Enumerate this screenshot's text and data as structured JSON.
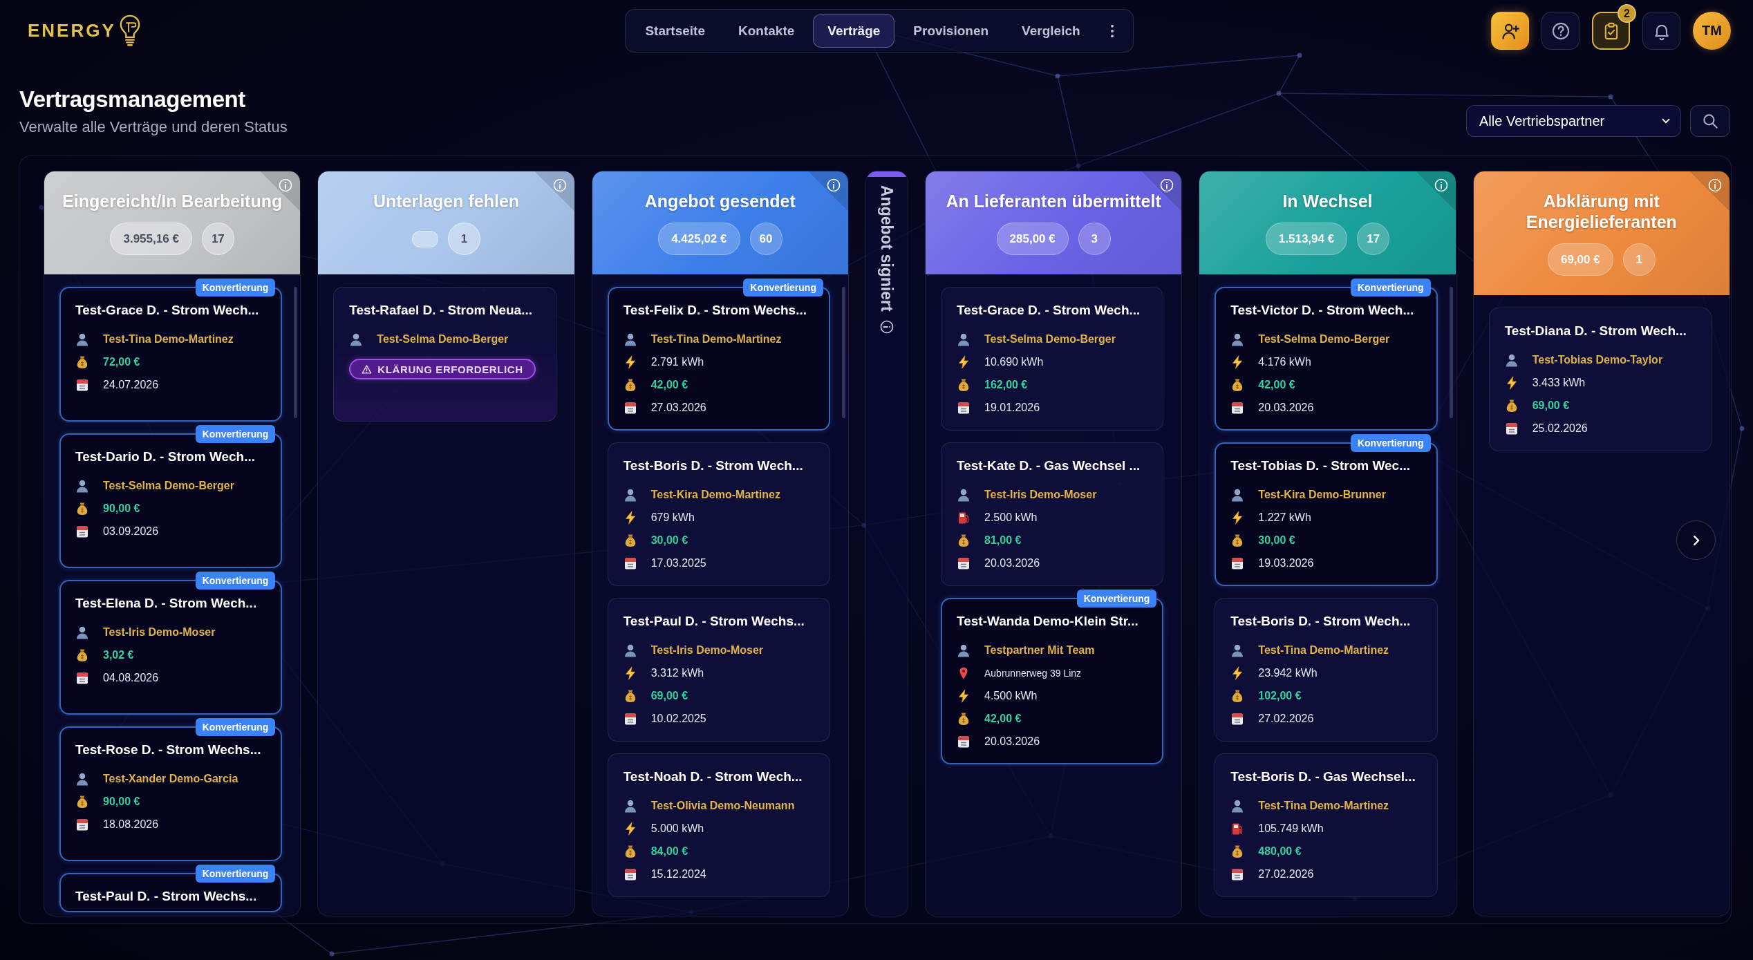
{
  "logo": {
    "text": "ENERGY"
  },
  "nav": {
    "items": [
      {
        "label": "Startseite",
        "selected": false
      },
      {
        "label": "Kontakte",
        "selected": false
      },
      {
        "label": "Verträge",
        "selected": true
      },
      {
        "label": "Provisionen",
        "selected": false
      },
      {
        "label": "Vergleich",
        "selected": false
      }
    ]
  },
  "actions": [
    {
      "kind": "add-contact"
    },
    {
      "kind": "help"
    },
    {
      "kind": "tasks",
      "badge": "2"
    },
    {
      "kind": "notifications"
    }
  ],
  "avatar": {
    "initials": "TM"
  },
  "page": {
    "title": "Vertragsmanagement",
    "subtitle": "Verwalte alle Verträge und deren Status"
  },
  "filter": {
    "value": "Alle Vertriebspartner"
  },
  "columns": [
    {
      "title": "Eingereicht/In Bearbeitung",
      "color": "#c4c5c9",
      "collapsed": false,
      "scrollable": true,
      "amount": "3.955,16 €",
      "count": "17",
      "cards": [
        {
          "title": "Test-Grace D. - Strom Wech...",
          "badge": "Konvertierung",
          "rows": [
            {
              "kind": "person",
              "text": "Test-Tina Demo-Martinez"
            },
            {
              "kind": "money",
              "text": "72,00 €"
            },
            {
              "kind": "date",
              "text": "24.07.2026"
            }
          ]
        },
        {
          "title": "Test-Dario D. - Strom Wech...",
          "badge": "Konvertierung",
          "rows": [
            {
              "kind": "person",
              "text": "Test-Selma Demo-Berger"
            },
            {
              "kind": "money",
              "text": "90,00 €"
            },
            {
              "kind": "date",
              "text": "03.09.2026"
            }
          ]
        },
        {
          "title": "Test-Elena D. - Strom Wech...",
          "badge": "Konvertierung",
          "rows": [
            {
              "kind": "person",
              "text": "Test-Iris Demo-Moser"
            },
            {
              "kind": "money",
              "text": "3,02 €"
            },
            {
              "kind": "date",
              "text": "04.08.2026"
            }
          ]
        },
        {
          "title": "Test-Rose D. - Strom Wechs...",
          "badge": "Konvertierung",
          "rows": [
            {
              "kind": "person",
              "text": "Test-Xander Demo-Garcia"
            },
            {
              "kind": "money",
              "text": "90,00 €"
            },
            {
              "kind": "date",
              "text": "18.08.2026"
            }
          ]
        },
        {
          "title": "Test-Paul D. - Strom Wechs...",
          "badge": "Konvertierung"
        }
      ]
    },
    {
      "title": "Unterlagen fehlen",
      "color": "#aac6ec",
      "collapsed": false,
      "scrollable": false,
      "count": "1",
      "cards": [
        {
          "title": "Test-Rafael D. - Strom Neua...",
          "rows": [
            {
              "kind": "person",
              "text": "Test-Selma Demo-Berger"
            }
          ],
          "alert": "KLÄRUNG ERFORDERLICH"
        }
      ]
    },
    {
      "title": "Angebot gesendet",
      "color": "#3d7fea",
      "collapsed": false,
      "scrollable": true,
      "amount": "4.425,02 €",
      "count": "60",
      "cards": [
        {
          "title": "Test-Felix D. - Strom Wechs...",
          "badge": "Konvertierung",
          "rows": [
            {
              "kind": "person",
              "text": "Test-Tina Demo-Martinez"
            },
            {
              "kind": "energy",
              "text": "2.791 kWh"
            },
            {
              "kind": "money",
              "text": "42,00 €"
            },
            {
              "kind": "date",
              "text": "27.03.2026"
            }
          ]
        },
        {
          "title": "Test-Boris D. - Strom Wech...",
          "rows": [
            {
              "kind": "person",
              "text": "Test-Kira Demo-Martinez"
            },
            {
              "kind": "energy",
              "text": "679 kWh"
            },
            {
              "kind": "money",
              "text": "30,00 €"
            },
            {
              "kind": "date",
              "text": "17.03.2025"
            }
          ]
        },
        {
          "title": "Test-Paul D. - Strom Wechs...",
          "rows": [
            {
              "kind": "person",
              "text": "Test-Iris Demo-Moser"
            },
            {
              "kind": "energy",
              "text": "3.312 kWh"
            },
            {
              "kind": "money",
              "text": "69,00 €"
            },
            {
              "kind": "date",
              "text": "10.02.2025"
            }
          ]
        },
        {
          "title": "Test-Noah D. - Strom Wech...",
          "rows": [
            {
              "kind": "person",
              "text": "Test-Olivia Demo-Neumann"
            },
            {
              "kind": "energy",
              "text": "5.000 kWh"
            },
            {
              "kind": "money",
              "text": "84,00 €"
            },
            {
              "kind": "date",
              "text": "15.12.2024"
            }
          ]
        }
      ]
    },
    {
      "title": "Angebot signiert",
      "color": "#7c5cf0",
      "collapsed": true
    },
    {
      "title": "An Lieferanten übermittelt",
      "color": "#6a63e6",
      "collapsed": false,
      "scrollable": false,
      "amount": "285,00 €",
      "count": "3",
      "cards": [
        {
          "title": "Test-Grace D. - Strom Wech...",
          "rows": [
            {
              "kind": "person",
              "text": "Test-Selma Demo-Berger"
            },
            {
              "kind": "energy",
              "text": "10.690 kWh"
            },
            {
              "kind": "money",
              "text": "162,00 €"
            },
            {
              "kind": "date",
              "text": "19.01.2026"
            }
          ]
        },
        {
          "title": "Test-Kate D. - Gas Wechsel ...",
          "rows": [
            {
              "kind": "person",
              "text": "Test-Iris Demo-Moser"
            },
            {
              "kind": "gas",
              "text": "2.500 kWh"
            },
            {
              "kind": "money",
              "text": "81,00 €"
            },
            {
              "kind": "date",
              "text": "20.03.2026"
            }
          ]
        },
        {
          "title": "Test-Wanda Demo-Klein Str...",
          "badge": "Konvertierung",
          "rows": [
            {
              "kind": "person",
              "text": "Testpartner Mit Team"
            },
            {
              "kind": "location",
              "text": "Aubrunnerweg 39 Linz"
            },
            {
              "kind": "energy",
              "text": "4.500 kWh"
            },
            {
              "kind": "money",
              "text": "42,00 €"
            },
            {
              "kind": "date",
              "text": "20.03.2026"
            }
          ]
        }
      ]
    },
    {
      "title": "In Wechsel",
      "color": "#1aa19b",
      "collapsed": false,
      "scrollable": true,
      "amount": "1.513,94 €",
      "count": "17",
      "cards": [
        {
          "title": "Test-Victor D. - Strom Wech...",
          "badge": "Konvertierung",
          "rows": [
            {
              "kind": "person",
              "text": "Test-Selma Demo-Berger"
            },
            {
              "kind": "energy",
              "text": "4.176 kWh"
            },
            {
              "kind": "money",
              "text": "42,00 €"
            },
            {
              "kind": "date",
              "text": "20.03.2026"
            }
          ]
        },
        {
          "title": "Test-Tobias D. - Strom Wec...",
          "badge": "Konvertierung",
          "rows": [
            {
              "kind": "person",
              "text": "Test-Kira Demo-Brunner"
            },
            {
              "kind": "energy",
              "text": "1.227 kWh"
            },
            {
              "kind": "money",
              "text": "30,00 €"
            },
            {
              "kind": "date",
              "text": "19.03.2026"
            }
          ]
        },
        {
          "title": "Test-Boris D. - Strom Wech...",
          "rows": [
            {
              "kind": "person",
              "text": "Test-Tina Demo-Martinez"
            },
            {
              "kind": "energy",
              "text": "23.942 kWh"
            },
            {
              "kind": "money",
              "text": "102,00 €"
            },
            {
              "kind": "date",
              "text": "27.02.2026"
            }
          ]
        },
        {
          "title": "Test-Boris D. - Gas Wechsel...",
          "rows": [
            {
              "kind": "person",
              "text": "Test-Tina Demo-Martinez"
            },
            {
              "kind": "gas",
              "text": "105.749 kWh"
            },
            {
              "kind": "money",
              "text": "480,00 €"
            },
            {
              "kind": "date",
              "text": "27.02.2026"
            }
          ]
        }
      ]
    },
    {
      "title": "Abklärung mit Energielieferanten",
      "color": "#ee8a3e",
      "collapsed": false,
      "scrollable": false,
      "amount": "69,00 €",
      "count": "1",
      "cards": [
        {
          "title": "Test-Diana D. - Strom Wech...",
          "rows": [
            {
              "kind": "person",
              "text": "Test-Tobias Demo-Taylor"
            },
            {
              "kind": "energy",
              "text": "3.433 kWh"
            },
            {
              "kind": "money",
              "text": "69,00 €"
            },
            {
              "kind": "date",
              "text": "25.02.2026"
            }
          ]
        }
      ]
    }
  ]
}
